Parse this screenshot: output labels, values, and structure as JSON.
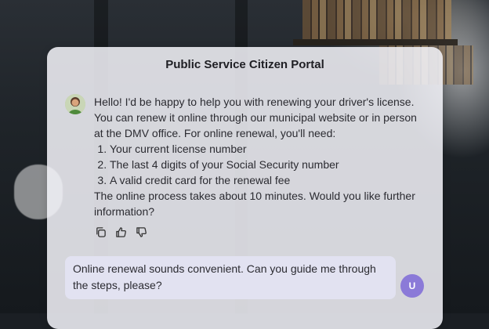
{
  "app": {
    "title": "Public Service Citizen Portal"
  },
  "assistant": {
    "avatar_icon": "assistant-avatar-icon",
    "message": {
      "intro": "Hello! I'd be happy to help you with renewing your driver's license. You can renew it online through our municipal website or in person at the DMV office. For online renewal, you'll need:",
      "requirements": [
        "Your current license number",
        "The last 4 digits of your Social Security number",
        "A valid credit card for the renewal fee"
      ],
      "outro": "The online process takes about 10 minutes. Would you like further information?"
    },
    "actions": [
      {
        "name": "copy-icon"
      },
      {
        "name": "thumbs-up-icon"
      },
      {
        "name": "thumbs-down-icon"
      }
    ]
  },
  "user": {
    "message": "Online renewal sounds convenient. Can you guide me through the steps, please?",
    "avatar_initial": "U",
    "avatar_color": "#8b7ad8"
  }
}
